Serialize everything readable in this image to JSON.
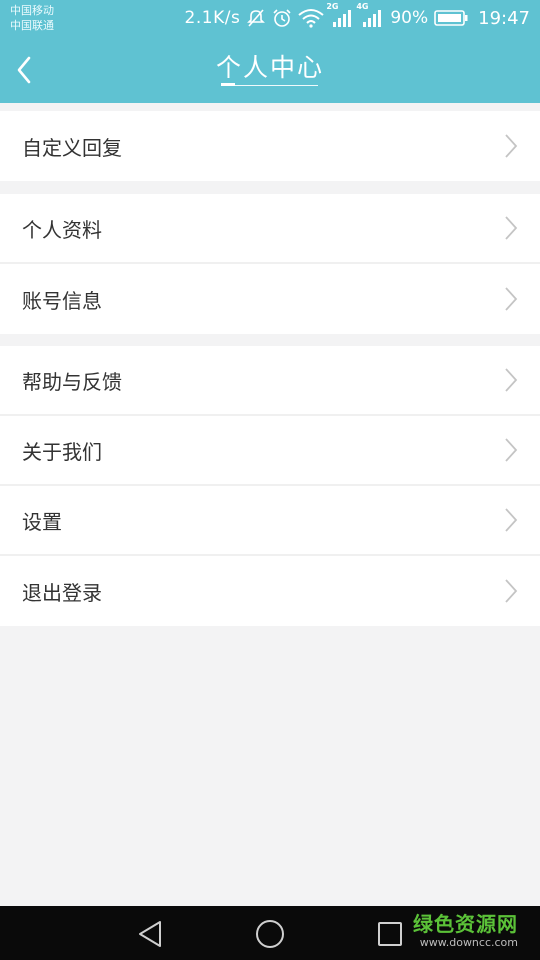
{
  "status_bar": {
    "carrier1": "中国移动",
    "carrier2": "中国联通",
    "net_speed": "2.1K/s",
    "sim1_tag": "2G",
    "sim2_tag": "4G",
    "battery_percent": "90%",
    "time": "19:47"
  },
  "header": {
    "title": "个人中心",
    "background_color": "#5fc2d2"
  },
  "menu": {
    "group1": [
      {
        "label": "自定义回复"
      }
    ],
    "group2": [
      {
        "label": "个人资料"
      },
      {
        "label": "账号信息"
      }
    ],
    "group3": [
      {
        "label": "帮助与反馈"
      },
      {
        "label": "关于我们"
      },
      {
        "label": "设置"
      },
      {
        "label": "退出登录"
      }
    ]
  },
  "watermark": {
    "title": "绿色资源网",
    "url": "www.downcc.com"
  }
}
